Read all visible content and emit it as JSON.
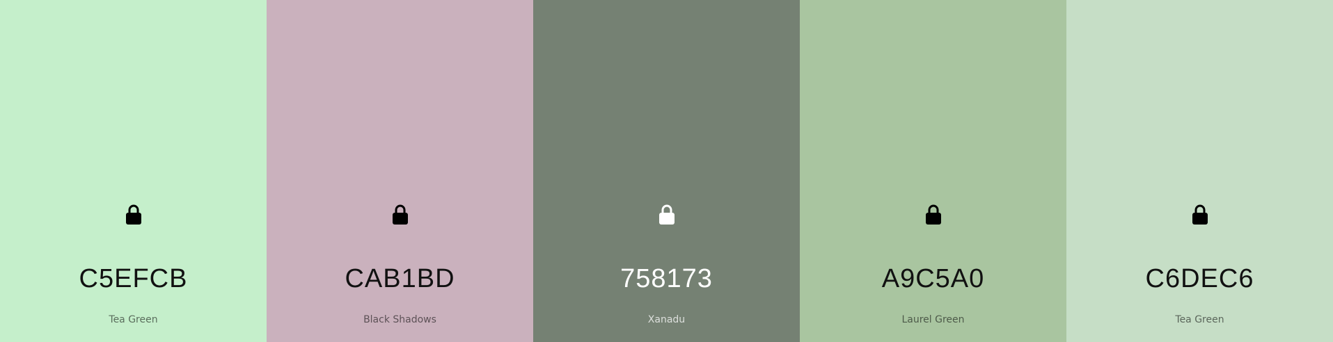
{
  "palette": {
    "colors": [
      {
        "hex": "C5EFCB",
        "name": "Tea Green",
        "color": "#C5EFCB",
        "icon": "lock-icon",
        "text_tone": "dark"
      },
      {
        "hex": "CAB1BD",
        "name": "Black Shadows",
        "color": "#CAB1BD",
        "icon": "lock-icon",
        "text_tone": "dark"
      },
      {
        "hex": "758173",
        "name": "Xanadu",
        "color": "#758173",
        "icon": "lock-icon",
        "text_tone": "light"
      },
      {
        "hex": "A9C5A0",
        "name": "Laurel Green",
        "color": "#A9C5A0",
        "icon": "lock-icon",
        "text_tone": "dark"
      },
      {
        "hex": "C6DEC6",
        "name": "Tea Green",
        "color": "#C6DEC6",
        "icon": "lock-icon",
        "text_tone": "dark"
      }
    ]
  }
}
